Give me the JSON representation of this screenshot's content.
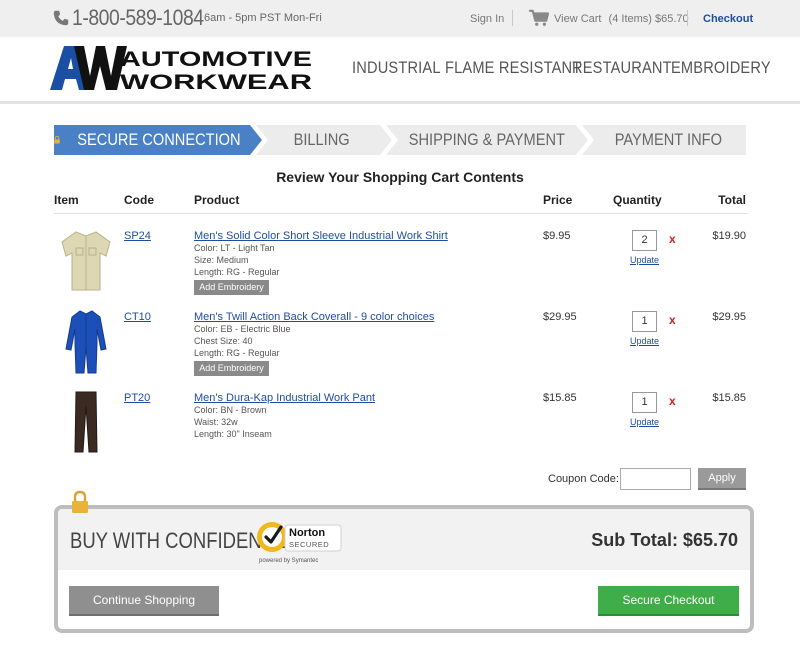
{
  "topbar": {
    "phone": "1-800-589-1084",
    "hours": "6am - 5pm PST Mon-Fri",
    "sign_in": "Sign In",
    "view_cart": "View Cart",
    "cart_summary": "(4 Items) $65.70",
    "checkout": "Checkout"
  },
  "logo": {
    "mark": "AW",
    "line1": "AUTOMOTIVE",
    "line2": "WORKWEAR"
  },
  "nav": [
    "INDUSTRIAL",
    "FLAME RESISTANT",
    "RESTAURANT",
    "EMBROIDERY"
  ],
  "steps": [
    "SECURE CONNECTION",
    "BILLING",
    "SHIPPING & PAYMENT",
    "PAYMENT INFO"
  ],
  "cart": {
    "title": "Review Your Shopping Cart Contents",
    "headers": {
      "item": "Item",
      "code": "Code",
      "product": "Product",
      "price": "Price",
      "quantity": "Quantity",
      "total": "Total"
    },
    "update_label": "Update",
    "remove_label": "x",
    "embroidery_label": "Add Embroidery",
    "items": [
      {
        "code": "SP24",
        "name": "Men's Solid Color Short Sleeve Industrial Work Shirt",
        "attrs": [
          "Color: LT - Light Tan",
          "Size: Medium",
          "Length: RG - Regular"
        ],
        "price": "$9.95",
        "qty": "2",
        "total": "$19.90",
        "thumb_color": "#ddd7b3"
      },
      {
        "code": "CT10",
        "name": "Men's Twill Action Back Coverall - 9 color choices",
        "attrs": [
          "Color: EB - Electric Blue",
          "Chest Size: 40",
          "Length: RG - Regular"
        ],
        "price": "$29.95",
        "qty": "1",
        "total": "$29.95",
        "thumb_color": "#1c4fb8"
      },
      {
        "code": "PT20",
        "name": "Men's Dura-Kap Industrial Work Pant",
        "attrs": [
          "Color: BN - Brown",
          "Waist: 32w",
          "Length: 30\" Inseam"
        ],
        "price": "$15.85",
        "qty": "1",
        "total": "$15.85",
        "thumb_color": "#3b2a22"
      }
    ],
    "coupon_label": "Coupon Code:",
    "coupon_value": "",
    "apply": "Apply"
  },
  "confidence": {
    "title": "BUY WITH CONFIDENCE",
    "norton_brand": "Norton",
    "norton_secured": "SECURED",
    "norton_powered": "powered by Symantec",
    "subtotal": "Sub Total: $65.70",
    "continue": "Continue Shopping",
    "secure_checkout": "Secure Checkout"
  },
  "colors": {
    "step_active": "#4a80c6",
    "step_inactive": "#ececec",
    "link": "#1f4ea0",
    "checkout_green": "#3fae49",
    "logo_blue": "#1b4fa6"
  }
}
